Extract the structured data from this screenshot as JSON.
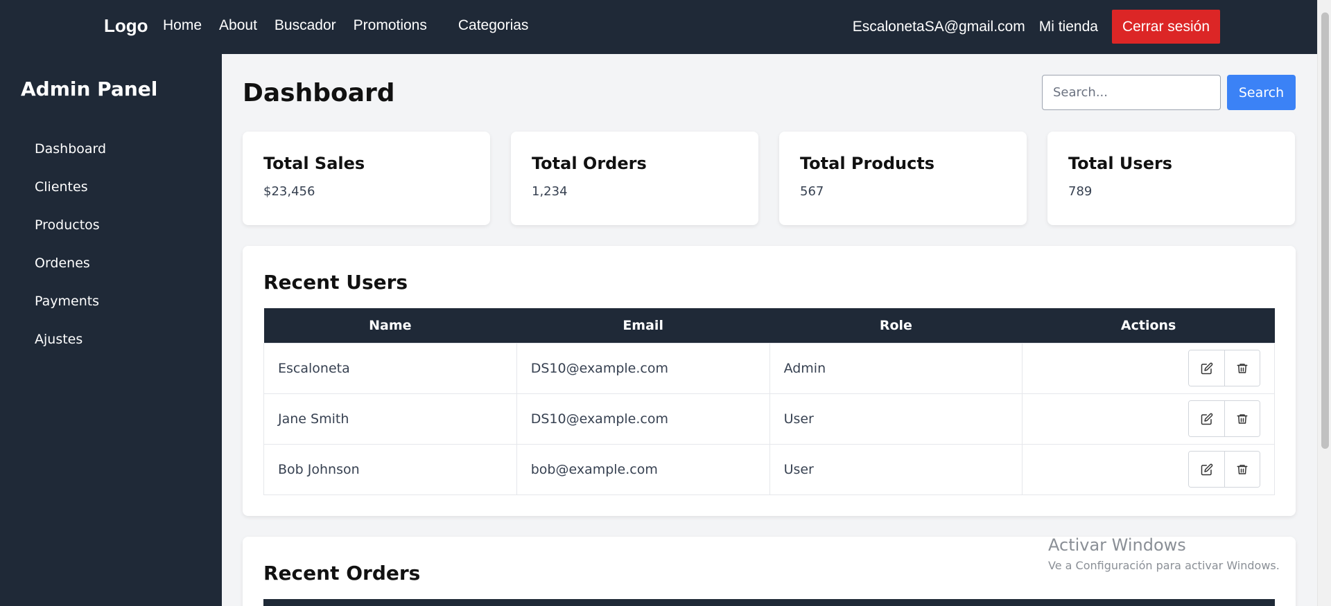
{
  "topbar": {
    "logo": "Logo",
    "nav": [
      "Home",
      "About",
      "Buscador",
      "Promotions",
      "Categorias"
    ],
    "email": "EscalonetaSA@gmail.com",
    "store": "Mi tienda",
    "logout": "Cerrar sesión"
  },
  "sidebar": {
    "title": "Admin Panel",
    "items": [
      "Dashboard",
      "Clientes",
      "Productos",
      "Ordenes",
      "Payments",
      "Ajustes"
    ]
  },
  "main": {
    "title": "Dashboard",
    "search_placeholder": "Search...",
    "search_button": "Search"
  },
  "stats": [
    {
      "label": "Total Sales",
      "value": "$23,456"
    },
    {
      "label": "Total Orders",
      "value": "1,234"
    },
    {
      "label": "Total Products",
      "value": "567"
    },
    {
      "label": "Total Users",
      "value": "789"
    }
  ],
  "users_table": {
    "title": "Recent Users",
    "columns": [
      "Name",
      "Email",
      "Role",
      "Actions"
    ],
    "rows": [
      {
        "name": "Escaloneta",
        "email": "DS10@example.com",
        "role": "Admin"
      },
      {
        "name": "Jane Smith",
        "email": "DS10@example.com",
        "role": "User"
      },
      {
        "name": "Bob Johnson",
        "email": "bob@example.com",
        "role": "User"
      }
    ]
  },
  "orders_table": {
    "title": "Recent Orders"
  },
  "watermark": {
    "line1": "Activar Windows",
    "line2": "Ve a Configuración para activar Windows."
  },
  "icons": {
    "edit": "edit-icon",
    "delete": "trash-icon"
  }
}
